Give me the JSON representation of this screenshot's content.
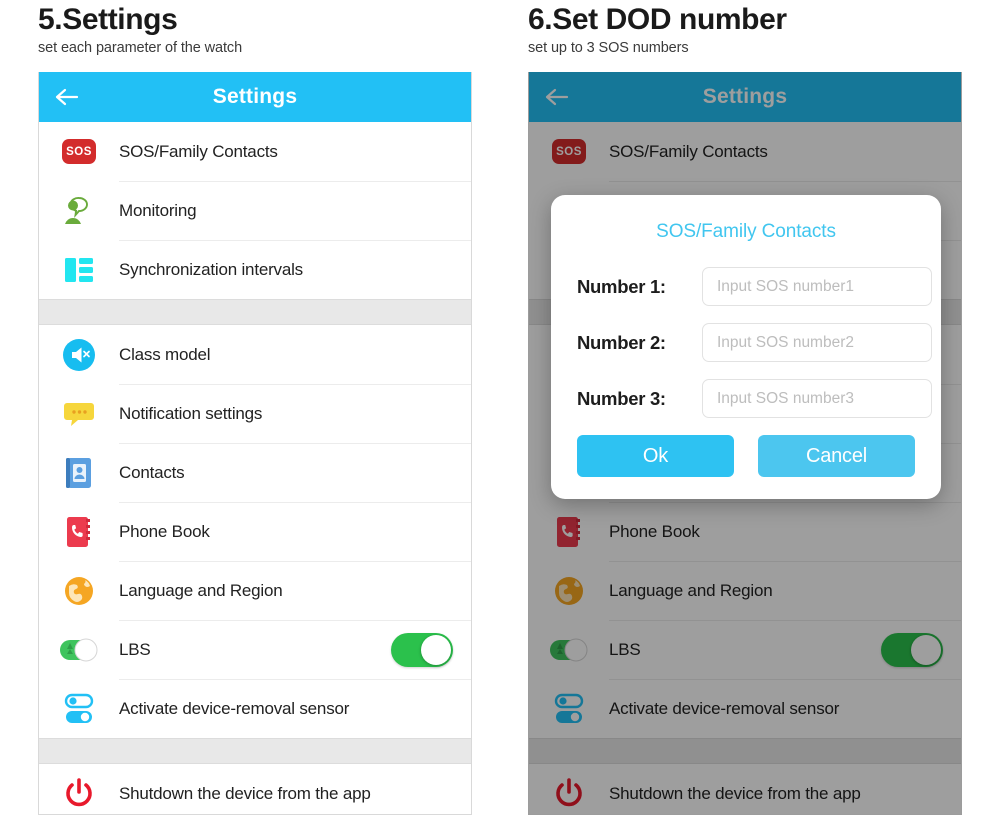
{
  "panels": [
    {
      "caption_title": "5.Settings",
      "caption_sub": "set each parameter of the watch",
      "appbar": {
        "title": "Settings",
        "back_icon": "arrow-left-icon"
      },
      "dimmed": false,
      "modal": null
    },
    {
      "caption_title": "6.Set DOD number",
      "caption_sub": "set up to 3 SOS numbers",
      "appbar": {
        "title": "Settings",
        "back_icon": "arrow-left-icon"
      },
      "dimmed": true,
      "modal": {
        "title": "SOS/Family Contacts",
        "fields": [
          {
            "label": "Number 1:",
            "value": "",
            "placeholder": "Input SOS number1"
          },
          {
            "label": "Number 2:",
            "value": "",
            "placeholder": "Input SOS number2"
          },
          {
            "label": "Number 3:",
            "value": "",
            "placeholder": "Input SOS number3"
          }
        ],
        "ok_label": "Ok",
        "cancel_label": "Cancel"
      }
    }
  ],
  "settings_list": {
    "groups": [
      {
        "items": [
          {
            "label": "SOS/Family Contacts",
            "icon": "sos-icon",
            "toggle": null
          },
          {
            "label": "Monitoring",
            "icon": "monitoring-person-icon",
            "toggle": null
          },
          {
            "label": "Synchronization intervals",
            "icon": "sync-intervals-icon",
            "toggle": null
          }
        ]
      },
      {
        "items": [
          {
            "label": "Class model",
            "icon": "speaker-mute-icon",
            "toggle": null
          },
          {
            "label": "Notification settings",
            "icon": "chat-bubble-icon",
            "toggle": null
          },
          {
            "label": "Contacts",
            "icon": "contacts-book-icon",
            "toggle": null
          },
          {
            "label": "Phone Book",
            "icon": "phone-book-icon",
            "toggle": null
          },
          {
            "label": "Language and Region",
            "icon": "globe-icon",
            "toggle": null
          },
          {
            "label": "LBS",
            "icon": "lbs-toggle-icon",
            "toggle": "on"
          },
          {
            "label": "Activate device-removal sensor",
            "icon": "device-removal-icon",
            "toggle": null
          }
        ]
      },
      {
        "items": [
          {
            "label": "Shutdown the device from the app",
            "icon": "power-icon",
            "toggle": null
          }
        ]
      }
    ]
  },
  "colors": {
    "appbar_blue": "#22c0f5",
    "modal_title_blue": "#41c6ef",
    "button_blue": "#2ec2f2",
    "toggle_green": "#2bc14c",
    "sos_red": "#d32c2c",
    "group_gap_grey": "#e8e8e8"
  }
}
